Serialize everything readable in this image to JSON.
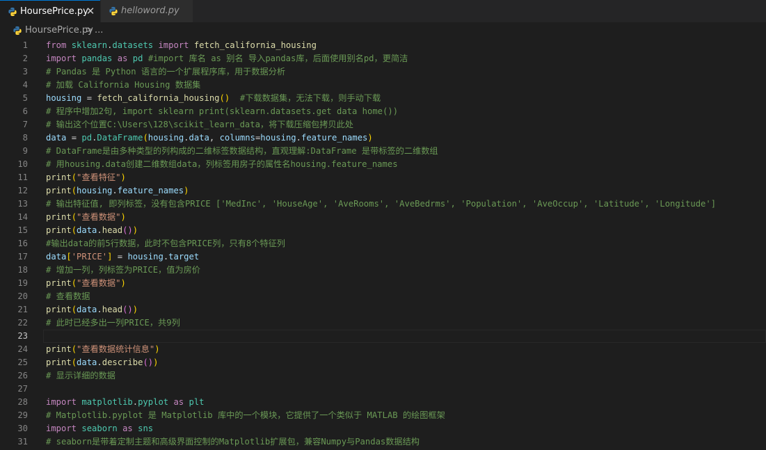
{
  "tabs": [
    {
      "label": "HoursePrice.py",
      "active": true,
      "icon": "python-icon"
    },
    {
      "label": "helloword.py",
      "active": false,
      "icon": "python-icon"
    }
  ],
  "tab_close_glyph": "✕",
  "breadcrumb": {
    "file": "HoursePrice.py",
    "separator": ">",
    "more": "..."
  },
  "colors": {
    "keyword": "#c586c0",
    "function": "#dcdcaa",
    "variable": "#9cdcfe",
    "namespace": "#4ec9b0",
    "string": "#ce9178",
    "comment": "#6a9955",
    "bracket1": "#ffd700",
    "bracket2": "#da70d6",
    "accent": "#0078d4",
    "python_icon_blue": "#3572a5",
    "python_icon_yellow": "#ffd43b"
  },
  "editor": {
    "current_line": 23,
    "lines": [
      {
        "n": "1",
        "tokens": [
          [
            "from",
            "kw"
          ],
          [
            " ",
            ""
          ],
          [
            "sklearn",
            "ns"
          ],
          [
            ".",
            ""
          ],
          [
            "datasets",
            "ns"
          ],
          [
            " ",
            ""
          ],
          [
            "import",
            "kw"
          ],
          [
            " ",
            ""
          ],
          [
            "fetch_california_housing",
            "fn"
          ]
        ]
      },
      {
        "n": "2",
        "tokens": [
          [
            "import",
            "kw"
          ],
          [
            " ",
            ""
          ],
          [
            "pandas",
            "ns"
          ],
          [
            " ",
            ""
          ],
          [
            "as",
            "kw"
          ],
          [
            " ",
            ""
          ],
          [
            "pd",
            "ns"
          ],
          [
            " ",
            ""
          ],
          [
            "#import 库名 as 别名 导入pandas库，后面使用别名pd，更简洁",
            "cm"
          ]
        ]
      },
      {
        "n": "3",
        "tokens": [
          [
            "# Pandas 是 Python 语言的一个扩展程序库，用于数据分析",
            "cm"
          ]
        ]
      },
      {
        "n": "4",
        "tokens": [
          [
            "# 加载 California Housing 数据集",
            "cm"
          ]
        ]
      },
      {
        "n": "5",
        "tokens": [
          [
            "housing",
            "var"
          ],
          [
            " = ",
            ""
          ],
          [
            "fetch_california_housing",
            "fn"
          ],
          [
            "()",
            "br1"
          ],
          [
            "  ",
            ""
          ],
          [
            "#下载数据集，无法下载，则手动下载",
            "cm"
          ]
        ]
      },
      {
        "n": "6",
        "tokens": [
          [
            "# 程序中增加2句, import sklearn print(sklearn.datasets.get data home())",
            "cm"
          ]
        ]
      },
      {
        "n": "7",
        "tokens": [
          [
            "# 输出这个位置C:\\Users\\128\\scikit_learn_data，将下载压缩包拷贝此处",
            "cm"
          ]
        ]
      },
      {
        "n": "8",
        "tokens": [
          [
            "data",
            "var"
          ],
          [
            " = ",
            ""
          ],
          [
            "pd",
            "ns"
          ],
          [
            ".",
            ""
          ],
          [
            "DataFrame",
            "ns"
          ],
          [
            "(",
            "br1"
          ],
          [
            "housing",
            "var"
          ],
          [
            ".",
            ""
          ],
          [
            "data",
            "var"
          ],
          [
            ", ",
            ""
          ],
          [
            "columns",
            "var"
          ],
          [
            "=",
            ""
          ],
          [
            "housing",
            "var"
          ],
          [
            ".",
            ""
          ],
          [
            "feature_names",
            "var"
          ],
          [
            ")",
            "br1"
          ]
        ]
      },
      {
        "n": "9",
        "tokens": [
          [
            "# DataFrame是由多种类型的列构成的二维标签数据结构，直观理解:DataFrame 是带标签的二维数组",
            "cm"
          ]
        ]
      },
      {
        "n": "10",
        "tokens": [
          [
            "# 用housing.data创建二维数组data，列标签用房子的属性名housing.feature_names",
            "cm"
          ]
        ]
      },
      {
        "n": "11",
        "tokens": [
          [
            "print",
            "fn"
          ],
          [
            "(",
            "br1"
          ],
          [
            "\"查看特征\"",
            "str"
          ],
          [
            ")",
            "br1"
          ]
        ]
      },
      {
        "n": "12",
        "tokens": [
          [
            "print",
            "fn"
          ],
          [
            "(",
            "br1"
          ],
          [
            "housing",
            "var"
          ],
          [
            ".",
            ""
          ],
          [
            "feature_names",
            "var"
          ],
          [
            ")",
            "br1"
          ]
        ]
      },
      {
        "n": "13",
        "tokens": [
          [
            "# 输出特征值, 即列标签，没有包含PRICE ['MedInc', 'HouseAge', 'AveRooms', 'AveBedrms', 'Population', 'AveOccup', 'Latitude', 'Longitude']",
            "cm"
          ]
        ]
      },
      {
        "n": "14",
        "tokens": [
          [
            "print",
            "fn"
          ],
          [
            "(",
            "br1"
          ],
          [
            "\"查看数据\"",
            "str"
          ],
          [
            ")",
            "br1"
          ]
        ]
      },
      {
        "n": "15",
        "tokens": [
          [
            "print",
            "fn"
          ],
          [
            "(",
            "br1"
          ],
          [
            "data",
            "var"
          ],
          [
            ".",
            ""
          ],
          [
            "head",
            "fn"
          ],
          [
            "()",
            "br2"
          ],
          [
            ")",
            "br1"
          ]
        ]
      },
      {
        "n": "16",
        "tokens": [
          [
            "#输出data的前5行数据，此时不包含PRICE列，只有8个特征列",
            "cm"
          ]
        ]
      },
      {
        "n": "17",
        "tokens": [
          [
            "data",
            "var"
          ],
          [
            "[",
            "br1"
          ],
          [
            "'PRICE'",
            "str"
          ],
          [
            "]",
            "br1"
          ],
          [
            " = ",
            ""
          ],
          [
            "housing",
            "var"
          ],
          [
            ".",
            ""
          ],
          [
            "target",
            "var"
          ]
        ]
      },
      {
        "n": "18",
        "tokens": [
          [
            "# 增加一列，列标签为PRICE，值为房价",
            "cm"
          ]
        ]
      },
      {
        "n": "19",
        "tokens": [
          [
            "print",
            "fn"
          ],
          [
            "(",
            "br1"
          ],
          [
            "\"查看数据\"",
            "str"
          ],
          [
            ")",
            "br1"
          ]
        ]
      },
      {
        "n": "20",
        "tokens": [
          [
            "# 查看数据",
            "cm"
          ]
        ]
      },
      {
        "n": "21",
        "tokens": [
          [
            "print",
            "fn"
          ],
          [
            "(",
            "br1"
          ],
          [
            "data",
            "var"
          ],
          [
            ".",
            ""
          ],
          [
            "head",
            "fn"
          ],
          [
            "()",
            "br2"
          ],
          [
            ")",
            "br1"
          ]
        ]
      },
      {
        "n": "22",
        "tokens": [
          [
            "# 此时已经多出一列PRICE，共9列",
            "cm"
          ]
        ]
      },
      {
        "n": "23",
        "tokens": []
      },
      {
        "n": "24",
        "tokens": [
          [
            "print",
            "fn"
          ],
          [
            "(",
            "br1"
          ],
          [
            "\"查看数据统计信息\"",
            "str"
          ],
          [
            ")",
            "br1"
          ]
        ]
      },
      {
        "n": "25",
        "tokens": [
          [
            "print",
            "fn"
          ],
          [
            "(",
            "br1"
          ],
          [
            "data",
            "var"
          ],
          [
            ".",
            ""
          ],
          [
            "describe",
            "fn"
          ],
          [
            "()",
            "br2"
          ],
          [
            ")",
            "br1"
          ]
        ]
      },
      {
        "n": "26",
        "tokens": [
          [
            "# 显示详细的数据",
            "cm"
          ]
        ]
      },
      {
        "n": "27",
        "tokens": []
      },
      {
        "n": "28",
        "tokens": [
          [
            "import",
            "kw"
          ],
          [
            " ",
            ""
          ],
          [
            "matplotlib",
            "ns"
          ],
          [
            ".",
            ""
          ],
          [
            "pyplot",
            "ns"
          ],
          [
            " ",
            ""
          ],
          [
            "as",
            "kw"
          ],
          [
            " ",
            ""
          ],
          [
            "plt",
            "ns"
          ]
        ]
      },
      {
        "n": "29",
        "tokens": [
          [
            "# Matplotlib.pyplot 是 Matplotlib 库中的一个模块，它提供了一个类似于 MATLAB 的绘图框架",
            "cm"
          ]
        ]
      },
      {
        "n": "30",
        "tokens": [
          [
            "import",
            "kw"
          ],
          [
            " ",
            ""
          ],
          [
            "seaborn",
            "ns"
          ],
          [
            " ",
            ""
          ],
          [
            "as",
            "kw"
          ],
          [
            " ",
            ""
          ],
          [
            "sns",
            "ns"
          ]
        ]
      },
      {
        "n": "31",
        "tokens": [
          [
            "# seaborn是带着定制主题和高级界面控制的Matplotlib扩展包，兼容Numpy与Pandas数据结构",
            "cm"
          ]
        ]
      }
    ]
  }
}
